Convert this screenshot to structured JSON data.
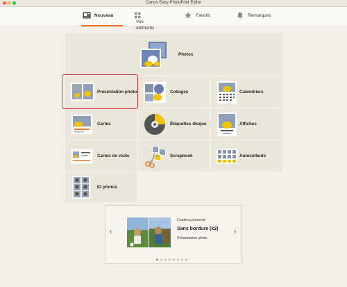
{
  "window": {
    "title": "Canon Easy-PhotoPrint Editor"
  },
  "tabs": [
    {
      "label": "Nouveau",
      "icon": "new-document-icon",
      "active": true
    },
    {
      "label": "Vos éléments",
      "icon": "grid-icon",
      "active": false
    },
    {
      "label": "Favoris",
      "icon": "star-icon",
      "active": false
    },
    {
      "label": "Remarques",
      "icon": "bell-icon",
      "active": false
    }
  ],
  "menu": {
    "photos": "Photos",
    "presentation": "Présentation photo",
    "collages": "Collages",
    "calendriers": "Calendriers",
    "cartes": "Cartes",
    "etiquettes": "Étiquettes disque",
    "affiches": "Affiches",
    "cartes_visite": "Cartes de visite",
    "scrapbook": "Scrapbook",
    "autocollants": "Autocollants",
    "id_photos": "ID photos"
  },
  "carousel": {
    "featured_label": "Contenu présenté",
    "title": "Sans bordure (x2)",
    "subtitle": "Présentation photo",
    "prev_label": "‹",
    "next_label": "›",
    "dot_count": 8,
    "active_dot": 0
  },
  "colors": {
    "accent": "#e8782e",
    "selection": "#d42b2b"
  }
}
